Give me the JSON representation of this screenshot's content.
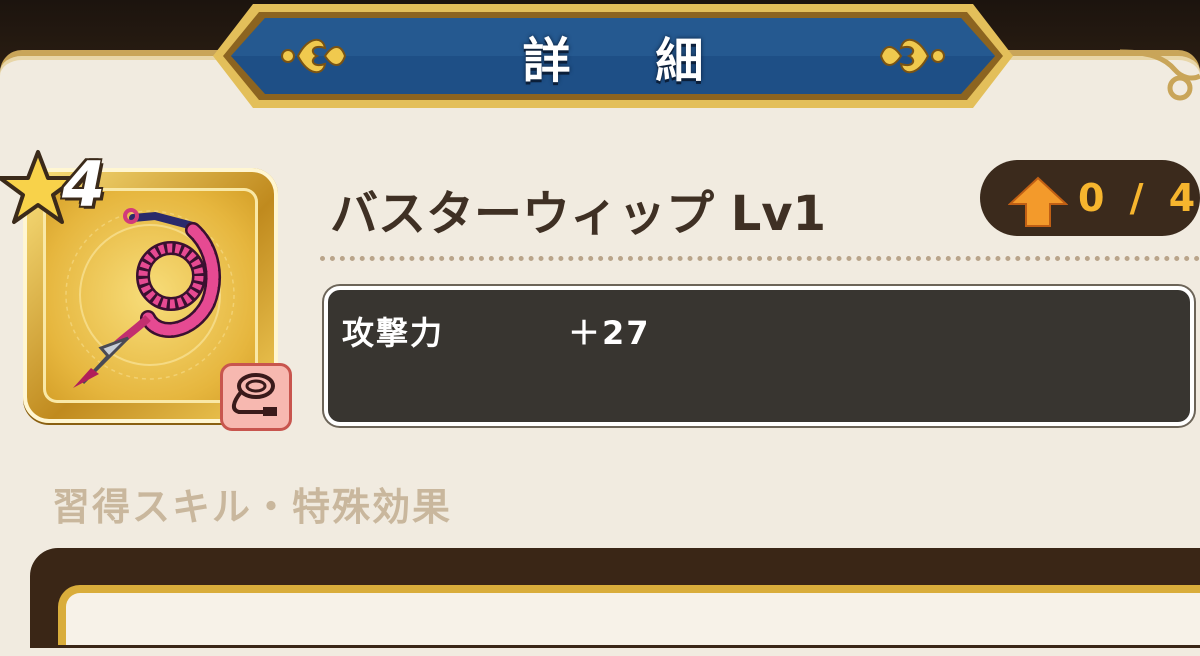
{
  "header": {
    "title": "詳 細"
  },
  "item": {
    "name": "バスターウィップ Lv1",
    "rarity": "4",
    "upgrade": "0 / 4"
  },
  "stats": [
    {
      "label": "攻撃力",
      "value": "＋27"
    }
  ],
  "skills": {
    "section_title": "習得スキル・特殊効果"
  },
  "colors": {
    "header_plate": "#1e4f86",
    "gold_frame": "#e0b040",
    "stat_box": "#383530",
    "upgrade_text": "#f6b52e"
  },
  "icons": [
    "fleur-de-lis-icon",
    "star-icon",
    "whip-icon",
    "whip-type-icon",
    "up-arrow-icon"
  ]
}
